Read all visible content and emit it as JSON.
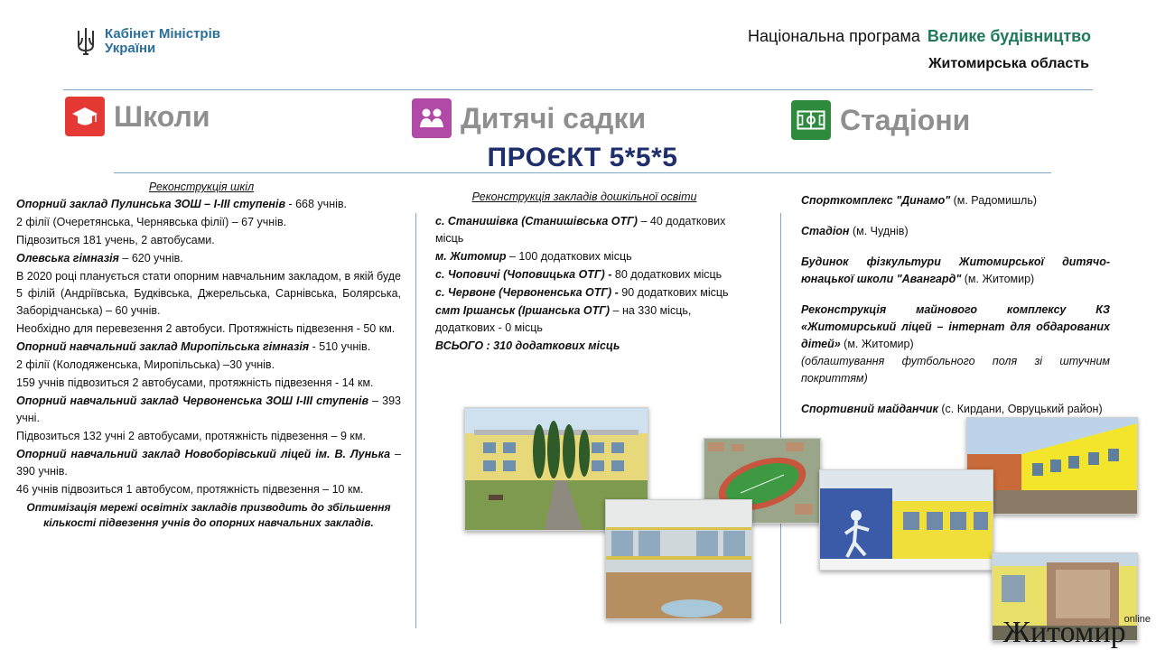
{
  "header": {
    "logo_line1": "Кабінет Міністрів",
    "logo_line2": "України",
    "program_label": "Національна програма",
    "program_name": "Велике будівництво",
    "region": "Житомирська область"
  },
  "categories": [
    {
      "label": "Школи",
      "icon": "graduation-cap-icon",
      "color": "#e53935"
    },
    {
      "label": "Дитячі садки",
      "icon": "children-icon",
      "color": "#b04aa6"
    },
    {
      "label": "Стадіони",
      "icon": "football-field-icon",
      "color": "#2e8b3e"
    }
  ],
  "project_title": "ПРОЄКТ 5*5*5",
  "schools": {
    "heading": "Реконструкція шкіл",
    "items": [
      {
        "title": "Опорний заклад Пулинська ЗОШ – І-ІІІ ступенів",
        "after": " -  668 учнів.",
        "lines": [
          "2 філії (Очеретянська, Чернявська філії) – 67 учнів.",
          "Підвозиться 181 учень, 2 автобусами."
        ]
      },
      {
        "title": "Олевська гімназія",
        "after": " – 620 учнів.",
        "lines": [
          "В 2020 році планується стати опорним навчальним закладом, в якій буде 5 філій (Андріївська, Будківська, Джерельська, Сарнівська, Болярська, Заборідчанська) – 60 учнів.",
          "Необхідно для перевезення 2 автобуси. Протяжність підвезення - 50 км."
        ]
      },
      {
        "title": "Опорний навчальний заклад Миропільська гімназія",
        "after": " - 510 учнів.",
        "lines": [
          "2 філії (Колодяженська, Миропільська) –30 учнів.",
          "159 учнів підвозиться 2 автобусами, протяжність підвезення - 14 км."
        ]
      },
      {
        "title": "Опорний навчальний заклад Червоненська ЗОШ І-ІІІ ступенів",
        "after": " – 393 учні.",
        "lines": [
          "Підвозиться 132 учні 2 автобусами, протяжність підвезення – 9 км."
        ]
      },
      {
        "title": "Опорний навчальний заклад Новоборівський ліцей ім. В. Лунька",
        "after": " – 390 учнів.",
        "lines": [
          "46 учнів підвозиться 1 автобусом, протяжність підвезення – 10 км."
        ]
      }
    ],
    "conclusion": "Оптимізація мережі освітніх закладів призводить до збільшення кількості підвезення учнів до опорних навчальних закладів."
  },
  "kindergartens": {
    "heading": "Реконструкція закладів дошкільної освіти",
    "items": [
      {
        "title": "с. Станишівка (Станишівська ОТГ)",
        "after": " – 40 додаткових місць"
      },
      {
        "title": "м. Житомир",
        "after": " – 100 додаткових місць"
      },
      {
        "title": "с. Чоповичі  (Чоповицька ОТГ) -",
        "after": " 80 додаткових місць"
      },
      {
        "title": "с. Червоне (Червоненська ОТГ) -",
        "after": " 90 додаткових місць"
      },
      {
        "title": "смт Іршанськ (Іршанська ОТГ)",
        "after": " – на 330 місць, додаткових - 0 місць"
      }
    ],
    "total": "ВСЬОГО : 310 додаткових місць"
  },
  "stadiums": {
    "items": [
      {
        "title": "Спорткомплекс \"Динамо\"",
        "after": " (м. Радомишль)",
        "note": ""
      },
      {
        "title": "Стадіон",
        "after": " (м. Чуднів)",
        "note": ""
      },
      {
        "title": "Будинок фізкультури Житомирської дитячо-юнацької школи \"Авангард\"",
        "after": " (м. Житомир)",
        "note": ""
      },
      {
        "title": "Реконструкція майнового комплексу КЗ «Житомирський ліцей – інтернат для обдарованих дітей»",
        "after": " (м. Житомир)",
        "note": "(облаштування футбольного поля зі штучним покриттям)"
      },
      {
        "title": "Спортивний майданчик",
        "after": " (с. Кирдани, Овруцький район)",
        "note": ""
      }
    ]
  },
  "watermark": {
    "main": "Житомир",
    "sub": "online"
  }
}
